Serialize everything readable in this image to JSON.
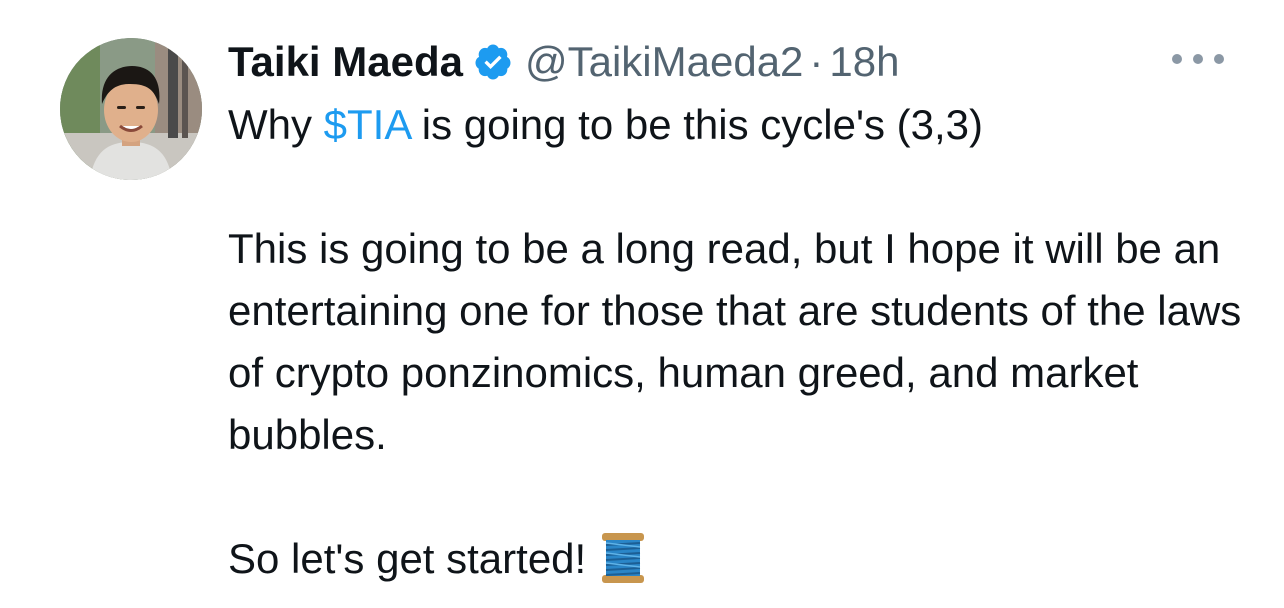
{
  "tweet": {
    "author": {
      "display_name": "Taiki Maeda",
      "handle": "@TaikiMaeda2",
      "verified_icon": "verified-badge-icon",
      "avatar_icon": "profile-photo"
    },
    "separator": "·",
    "timestamp": "18h",
    "more_icon": "more-options-icon",
    "text": {
      "line1_prefix": "Why ",
      "cashtag": "$TIA",
      "line1_suffix": " is going to be this cycle's (3,3)",
      "paragraph2": "This is going to be a long read, but I hope it will be an entertaining one for those that are students of the laws of crypto ponzinomics, human greed, and market bubbles.",
      "paragraph3": "So let's get started!",
      "emoji_icon": "spool-of-thread-emoji"
    },
    "colors": {
      "link": "#1d9bf0",
      "secondary": "#536471",
      "primary": "#0f1419",
      "verified": "#1d9bf0"
    }
  }
}
